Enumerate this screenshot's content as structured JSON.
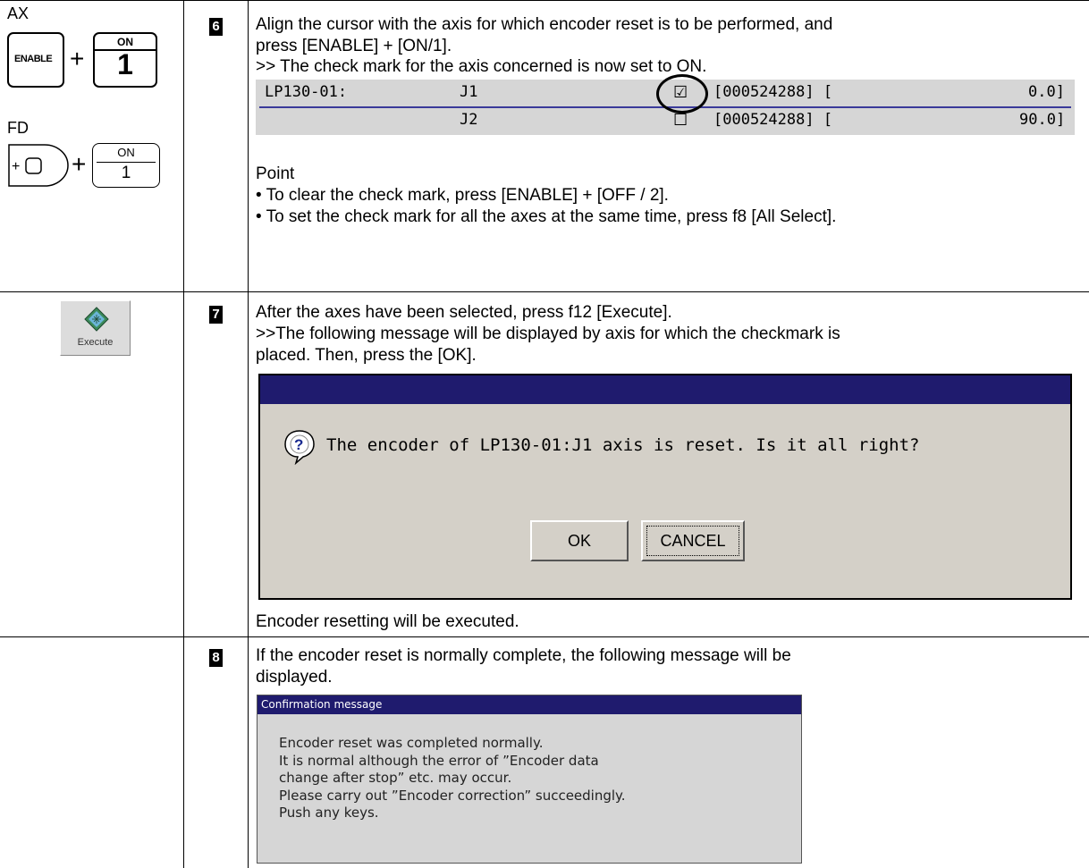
{
  "step6": {
    "number": "6",
    "keys": {
      "ax_label": "AX",
      "enable_key": "ENABLE",
      "on_key_top": "ON",
      "on_key_bottom": "1",
      "fd_label": "FD",
      "fd_on_top": "ON",
      "fd_on_bottom": "1",
      "plus": "+"
    },
    "line1": "Align the cursor with the axis for which encoder reset is to be performed, and",
    "line2": "press [ENABLE] + [ON/1].",
    "line3": ">> The check mark for the axis concerned is now set to ON.",
    "axis_table": {
      "row1": {
        "robot": "LP130-01:",
        "axis": "J1",
        "check": "☑",
        "value": "[000524288] [",
        "angle": "0.0]"
      },
      "row2": {
        "robot": "",
        "axis": "J2",
        "check": "☐",
        "value": "[000524288] [",
        "angle": "90.0]"
      }
    },
    "point_title": "Point",
    "point1": "• To clear the check mark, press [ENABLE] + [OFF / 2].",
    "point2": "• To set the check mark for all the axes at the same time, press f8 [All Select]."
  },
  "step7": {
    "number": "7",
    "execute_label": "Execute",
    "line1": "After the axes have been selected, press f12 [Execute].",
    "line2": ">>The following message will be displayed by axis for which the checkmark is",
    "line3": "placed. Then, press the [OK].",
    "dialog": {
      "message": "The encoder of LP130-01:J1  axis is reset. Is it all right?",
      "ok_label": "OK",
      "cancel_label": "CANCEL"
    },
    "after": "Encoder resetting will be executed."
  },
  "step8": {
    "number": "8",
    "line1": "If the encoder reset is normally complete, the following message will be",
    "line2": "displayed.",
    "dialog": {
      "title": "Confirmation message",
      "lines": [
        "Encoder reset was completed normally.",
        "It is normal although the error of ”Encoder data",
        "change after stop” etc. may occur.",
        "Please carry out ”Encoder correction” succeedingly.",
        "Push any keys."
      ]
    }
  },
  "colors": {
    "title_bar": "#1f1b6e",
    "dialog_bg": "#d4d0c8",
    "panel_bg": "#d6d6d6",
    "axis_line": "#3a3a9a"
  }
}
